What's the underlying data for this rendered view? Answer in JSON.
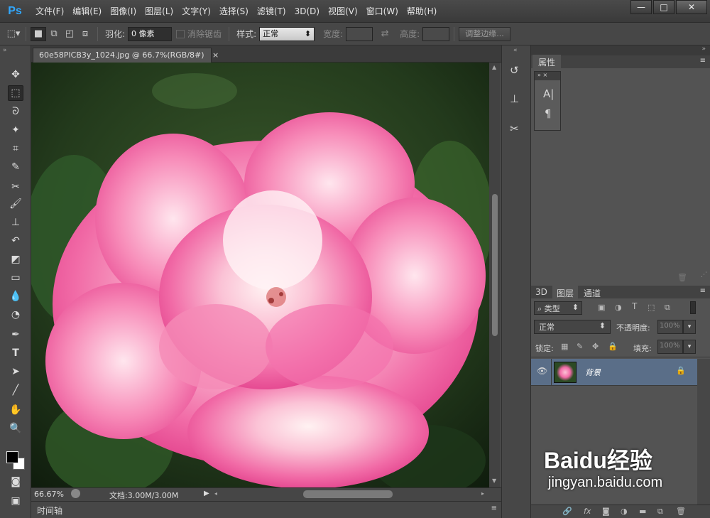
{
  "app": {
    "logo": "Ps"
  },
  "menu": [
    "文件(F)",
    "编辑(E)",
    "图像(I)",
    "图层(L)",
    "文字(Y)",
    "选择(S)",
    "滤镜(T)",
    "3D(D)",
    "视图(V)",
    "窗口(W)",
    "帮助(H)"
  ],
  "window_controls": {
    "minimize": "—",
    "maximize": "□",
    "close": "✕"
  },
  "options": {
    "feather_label": "羽化:",
    "feather_value": "0 像素",
    "antialias_label": "消除锯齿",
    "style_label": "样式:",
    "style_value": "正常",
    "width_label": "宽度:",
    "height_label": "高度:",
    "refine_edge": "调整边缘..."
  },
  "document": {
    "tab_title": "60e58PICB3y_1024.jpg @ 66.7%(RGB/8#)",
    "tab_close": "×",
    "zoom": "66.67%",
    "doc_size": "文档:3.00M/3.00M"
  },
  "timeline": {
    "label": "时间轴"
  },
  "properties_panel": {
    "title": "属性"
  },
  "mini_panel": {
    "char_glyph": "A|",
    "para_glyph": "¶"
  },
  "layers_panel": {
    "tabs": [
      "3D",
      "图层",
      "通道"
    ],
    "active_tab": "图层",
    "filter_label": "类型",
    "blend_mode": "正常",
    "opacity_label": "不透明度:",
    "opacity_value": "100%",
    "lock_label": "锁定:",
    "fill_label": "填充:",
    "fill_value": "100%",
    "layer": {
      "name": "背景",
      "visible": true,
      "locked": true
    }
  },
  "watermark": {
    "brand": "Baidu经验",
    "url": "jingyan.baidu.com"
  },
  "colors": {
    "accent": "#31a8ff",
    "layer_selected": "#5a6e88",
    "canvas_bg": "#535353"
  }
}
